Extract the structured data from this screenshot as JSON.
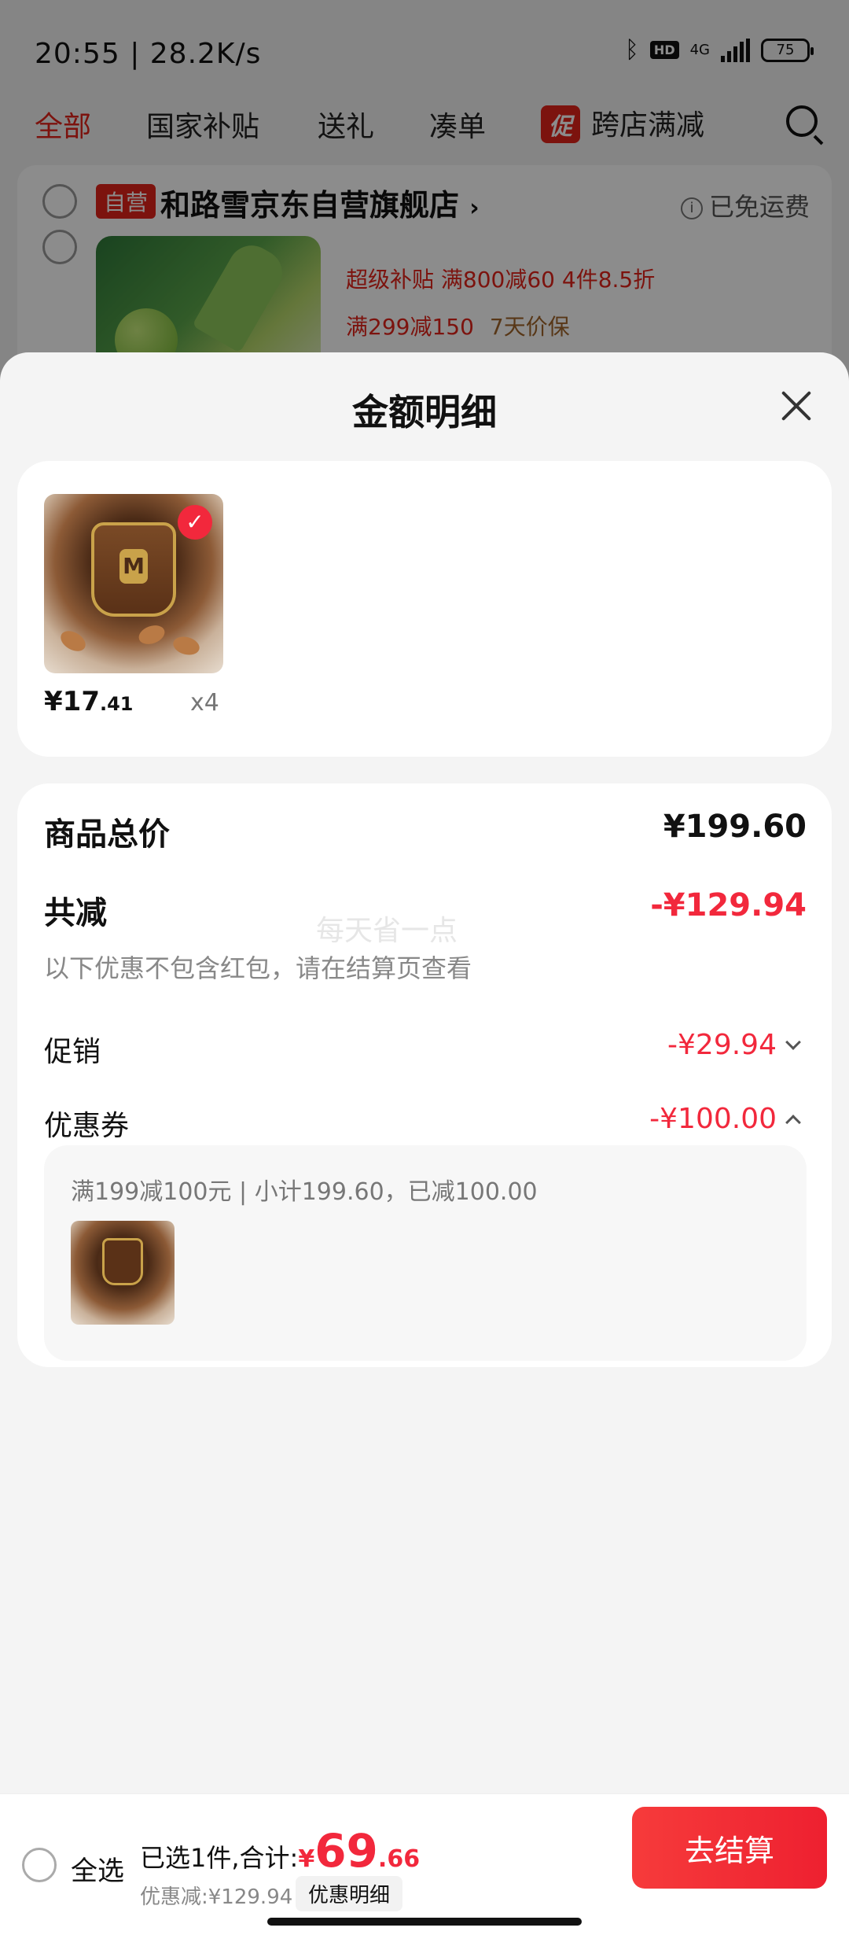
{
  "status_bar": {
    "time": "20:55 | 28.2K/s",
    "network": "4G",
    "battery": "75"
  },
  "tabs": [
    {
      "label": "全部",
      "active": true
    },
    {
      "label": "国家补贴",
      "active": false
    },
    {
      "label": "送礼",
      "active": false
    },
    {
      "label": "凑单",
      "active": false
    },
    {
      "badge": "促",
      "label": "跨店满减",
      "active": false
    }
  ],
  "store": {
    "badge": "自营",
    "name": "和路雪京东自营旗舰店",
    "chevron": "›",
    "shipping": "已免运费",
    "promo1": "超级补贴 满800减60  4件8.5折",
    "promo2": "满299减150",
    "promo2_extra": "7天价保"
  },
  "sheet": {
    "title": "金额明细",
    "item": {
      "price_int": "¥17",
      "price_dec": ".41",
      "qty": "x4"
    },
    "summary": {
      "total_label": "商品总价",
      "total_value": "¥199.60",
      "reduce_label": "共减",
      "reduce_value": "-¥129.94",
      "watermark": "每天省一点",
      "note": "以下优惠不包含红包，请在结算页查看",
      "promo_label": "促销",
      "promo_value": "-¥29.94",
      "coupon_label": "优惠券",
      "coupon_value": "-¥100.00",
      "coupon_detail": "满199减100元 | 小计199.60，已减100.00"
    }
  },
  "bottom_bar": {
    "select_all": "全选",
    "selected_prefix": "已选1件,合计:",
    "currency": "¥",
    "total_int": "69",
    "total_dec": ".66",
    "discount": "优惠减:¥129.94",
    "detail_button": "优惠明细",
    "checkout": "去结算"
  },
  "colors": {
    "accent": "#f2283c",
    "brand_red": "#e2231a"
  }
}
